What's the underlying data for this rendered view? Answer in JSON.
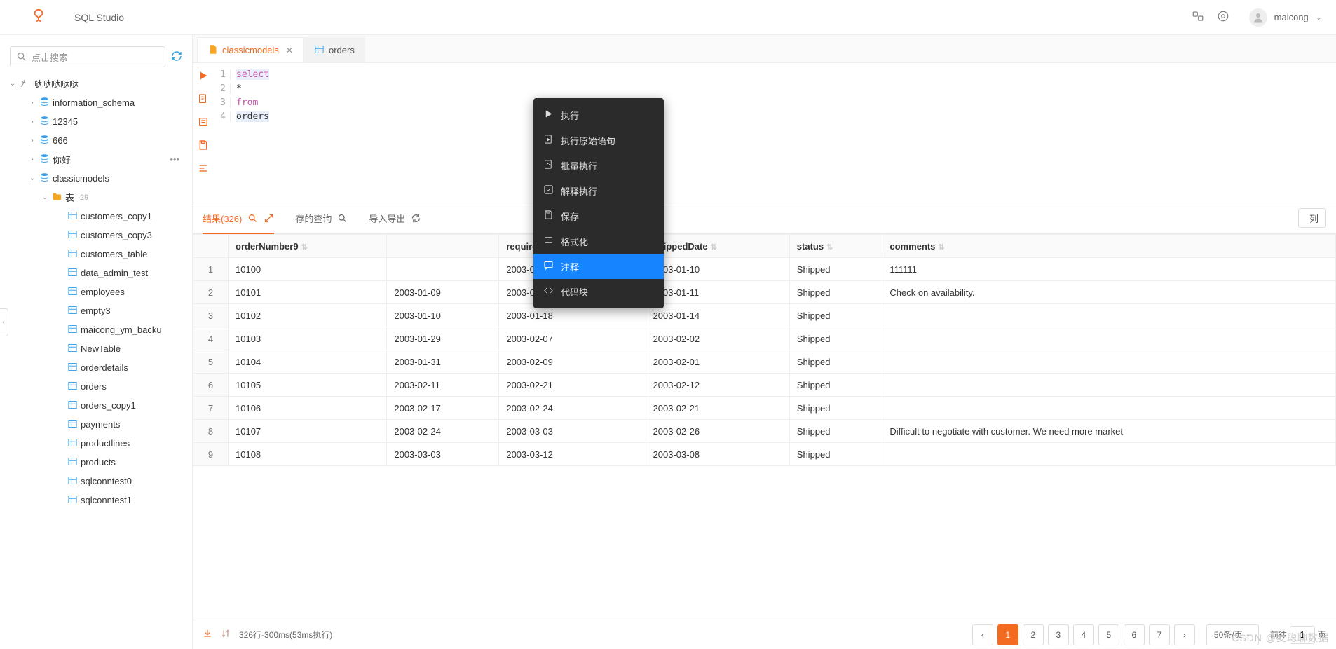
{
  "header": {
    "title": "SQL Studio",
    "username": "maicong"
  },
  "sidebar": {
    "search_placeholder": "点击搜索",
    "connection": "哒哒哒哒哒",
    "databases": [
      "information_schema",
      "12345",
      "666",
      "你好",
      "classicmodels"
    ],
    "tables_folder_label": "表",
    "tables_count": "29",
    "tables": [
      "customers_copy1",
      "customers_copy3",
      "customers_table",
      "data_admin_test",
      "employees",
      "empty3",
      "maicong_ym_backu",
      "NewTable",
      "orderdetails",
      "orders",
      "orders_copy1",
      "payments",
      "productlines",
      "products",
      "sqlconntest0",
      "sqlconntest1"
    ]
  },
  "tabs": [
    {
      "label": "classicmodels",
      "type": "sql",
      "active": true,
      "closable": true
    },
    {
      "label": "orders",
      "type": "table",
      "active": false,
      "closable": false
    }
  ],
  "editor": {
    "lines": [
      {
        "n": "1",
        "tokens": [
          {
            "t": "select",
            "c": "kw hl"
          }
        ]
      },
      {
        "n": "2",
        "tokens": [
          {
            "t": "  *",
            "c": "ident"
          }
        ]
      },
      {
        "n": "3",
        "tokens": [
          {
            "t": "from",
            "c": "kw"
          }
        ]
      },
      {
        "n": "4",
        "tokens": [
          {
            "t": "  orders",
            "c": "ident hl"
          }
        ]
      }
    ]
  },
  "context_menu": {
    "items": [
      {
        "icon": "play",
        "label": "执行"
      },
      {
        "icon": "play-doc",
        "label": "执行原始语句"
      },
      {
        "icon": "batch",
        "label": "批量执行"
      },
      {
        "icon": "check",
        "label": "解释执行"
      },
      {
        "icon": "save",
        "label": "保存"
      },
      {
        "icon": "format",
        "label": "格式化"
      },
      {
        "icon": "comment",
        "label": "注释",
        "hover": true
      },
      {
        "icon": "code",
        "label": "代码块"
      }
    ]
  },
  "result_tabs": {
    "results_label": "结果(326)",
    "saved_label": "存的查询",
    "export_label": "导入导出",
    "columns_btn": "列"
  },
  "table": {
    "columns": [
      "orderNumber9",
      "",
      "requiredDate",
      "shippedDate",
      "status",
      "comments"
    ],
    "rows": [
      [
        "10100",
        "",
        "2003-01-13",
        "2003-01-10",
        "Shipped",
        "111111"
      ],
      [
        "10101",
        "2003-01-09",
        "2003-01-18",
        "2003-01-11",
        "Shipped",
        "Check on availability."
      ],
      [
        "10102",
        "2003-01-10",
        "2003-01-18",
        "2003-01-14",
        "Shipped",
        ""
      ],
      [
        "10103",
        "2003-01-29",
        "2003-02-07",
        "2003-02-02",
        "Shipped",
        ""
      ],
      [
        "10104",
        "2003-01-31",
        "2003-02-09",
        "2003-02-01",
        "Shipped",
        ""
      ],
      [
        "10105",
        "2003-02-11",
        "2003-02-21",
        "2003-02-12",
        "Shipped",
        ""
      ],
      [
        "10106",
        "2003-02-17",
        "2003-02-24",
        "2003-02-21",
        "Shipped",
        ""
      ],
      [
        "10107",
        "2003-02-24",
        "2003-03-03",
        "2003-02-26",
        "Shipped",
        "Difficult to negotiate with customer. We need more market"
      ],
      [
        "10108",
        "2003-03-03",
        "2003-03-12",
        "2003-03-08",
        "Shipped",
        ""
      ]
    ]
  },
  "footer": {
    "stats": "326行-300ms(53ms执行)",
    "pages": [
      "1",
      "2",
      "3",
      "4",
      "5",
      "6",
      "7"
    ],
    "page_size": "50条/页",
    "jump_prefix": "前往",
    "jump_value": "1",
    "jump_suffix": "页"
  },
  "watermark": "CSDN @麦聪聊数据"
}
